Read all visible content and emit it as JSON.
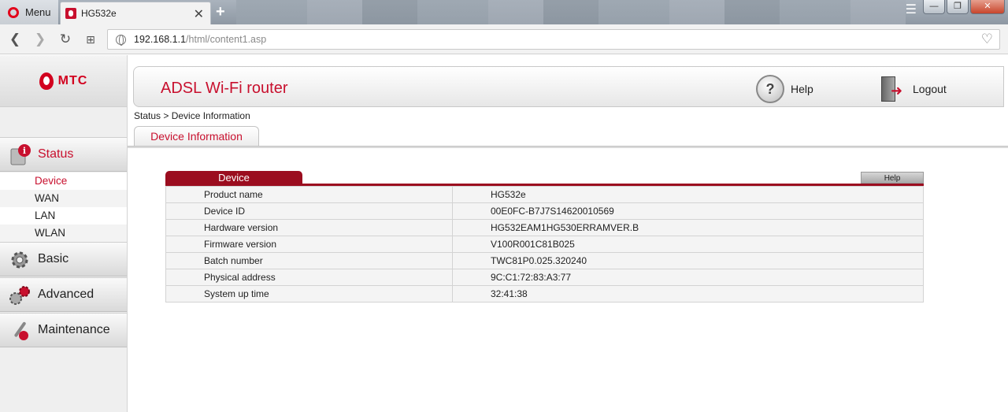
{
  "browser": {
    "menu_label": "Menu",
    "tab_title": "HG532e",
    "close_glyph": "✕",
    "new_tab_glyph": "+",
    "url_host": "192.168.1.1",
    "url_path": "/html/content1.asp"
  },
  "brand": {
    "logo_text": "МТС",
    "color": "#c8102e"
  },
  "header": {
    "title": "ADSL Wi-Fi router",
    "help_label": "Help",
    "logout_label": "Logout"
  },
  "sidebar": {
    "status": "Status",
    "status_items": [
      "Device",
      "WAN",
      "LAN",
      "WLAN"
    ],
    "basic": "Basic",
    "advanced": "Advanced",
    "maintenance": "Maintenance"
  },
  "breadcrumb": "Status > Device Information",
  "subtab": "Device Information",
  "panel": {
    "title": "Device",
    "help_label": "Help",
    "rows": [
      {
        "label": "Product name",
        "value": "HG532e"
      },
      {
        "label": "Device ID",
        "value": "00E0FC-B7J7S14620010569"
      },
      {
        "label": "Hardware version",
        "value": "HG532EAM1HG530ERRAMVER.B"
      },
      {
        "label": "Firmware version",
        "value": "V100R001C81B025"
      },
      {
        "label": "Batch number",
        "value": "TWC81P0.025.320240"
      },
      {
        "label": "Physical address",
        "value": "9C:C1:72:83:A3:77"
      },
      {
        "label": "System up time",
        "value": "32:41:38"
      }
    ]
  }
}
